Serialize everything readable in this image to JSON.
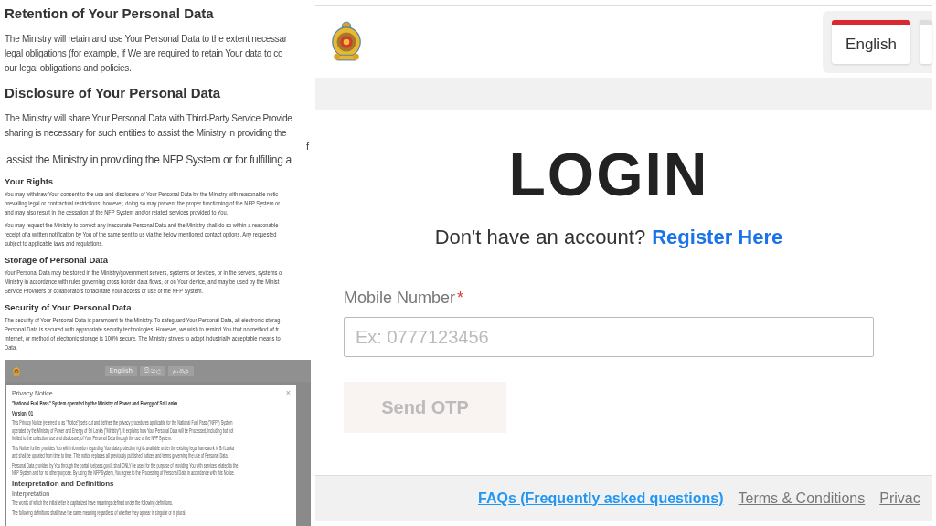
{
  "policy": {
    "blocks": [
      {
        "kind": "heading",
        "text": "Retention of Your Personal Data"
      },
      {
        "kind": "paragraph",
        "lines": [
          "The Ministry will retain and use Your Personal Data to the extent necessar",
          "legal obligations (for example, if We are required to retain Your data to co",
          "our legal obligations and policies."
        ]
      },
      {
        "kind": "heading",
        "text": "Disclosure of Your Personal Data"
      },
      {
        "kind": "paragraph",
        "lines": [
          "The Ministry will share Your Personal Data with Third-Party Service Provide",
          "sharing is necessary for such entities to assist the Ministry in providing the"
        ]
      },
      {
        "kind": "fragment",
        "text": "f"
      },
      {
        "kind": "zoomed",
        "text": "assist the Ministry in providing the NFP System or for fulfilling a"
      },
      {
        "kind": "subheading",
        "text": "Your Rights"
      },
      {
        "kind": "small",
        "lines": [
          "You may withdraw Your consent to the use and disclosure of Your Personal Data by the Ministry with reasonable notic",
          "prevailing legal or contractual restrictions; however, doing so may prevent the proper functioning of the NFP System or",
          "and may also result in the cessation of the NFP System and/or related services provided to You."
        ]
      },
      {
        "kind": "small",
        "lines": [
          "You may request the Ministry to correct any inaccurate Personal Data and the Ministry shall do so within a reasonable",
          "receipt of a written notification by You of the same sent to us via the below mentioned contact options. Any requested",
          "subject to applicable laws and regulations."
        ]
      },
      {
        "kind": "subheading",
        "text": "Storage of Personal Data"
      },
      {
        "kind": "small",
        "lines": [
          "Your Personal Data may be stored in the Ministry/government servers, systems or devices, or in the servers, systems o",
          "Ministry in accordance with rules governing cross border data flows, or on Your device, and may be used by the Minist",
          "Service Providers or collaborators to facilitate Your access or use of the NFP System."
        ]
      },
      {
        "kind": "subheading",
        "text": "Security of Your Personal Data"
      },
      {
        "kind": "small",
        "lines": [
          "The security of Your Personal Data is paramount to the Ministry. To safeguard Your Personal Data, all electronic storag",
          "Personal Data is secured with appropriate security technologies. However, we wish to remind You that no method of tr",
          "Internet, or method of electronic storage is 100% secure. The Ministry strives to adopt industrially acceptable means to",
          "Data."
        ]
      }
    ]
  },
  "embedded": {
    "languages": [
      "English",
      "සිංහල",
      "தமிழ்"
    ],
    "modal": {
      "title": "Privacy Notice",
      "close": "×",
      "blocks": [
        {
          "kind": "bold",
          "lines": [
            "\"National Fuel Pass\" System operated by the Ministry of Power and Energy of Sri Lanka"
          ]
        },
        {
          "kind": "bold",
          "lines": [
            "Version: 01"
          ]
        },
        {
          "kind": "paragraph",
          "lines": [
            "This Privacy Notice (referred to as \"Notice\") sets out and defines the privacy procedures applicable for the National Fuel Pass (\"NFP\") System",
            "operated by the Ministry of Power and Energy of Sri Lanka (\"Ministry\"). It explains how Your Personal Data will be Processed, including but not",
            "limited to the collection, use and disclosure, of Your Personal Data through the use of the NFP System."
          ]
        },
        {
          "kind": "paragraph",
          "lines": [
            "This Notice further provides You with information regarding Your data protection rights available under the existing legal framework in Sri Lanka",
            "and shall be updated from time to time. This notice replaces all previously published notices and terms governing the use of Personal Data."
          ]
        },
        {
          "kind": "paragraph",
          "lines": [
            "Personal Data provided by You through the portal fuelpass.gov.lk shall ONLY be used for the purpose of providing You with services related to the",
            "NFP System and for no other purpose. By using the NFP System, You agree to the Processing of Personal Data in accordance with this Notice."
          ]
        },
        {
          "kind": "heading",
          "lines": [
            "Interpretation and Definitions"
          ]
        },
        {
          "kind": "subheading",
          "lines": [
            "Interpretation"
          ]
        },
        {
          "kind": "paragraph",
          "lines": [
            "The words of which the initial letter is capitalized have meanings defined under the following definitions."
          ]
        },
        {
          "kind": "paragraph",
          "lines": [
            "The following definitions shall have the same meaning regardless of whether they appear in singular or in plural."
          ]
        }
      ]
    }
  },
  "login": {
    "language_tabs": [
      {
        "label": "English",
        "selected": true
      },
      {
        "selected": false
      }
    ],
    "title": "LOGIN",
    "prompt": "Don't have an account?",
    "register_link": "Register Here",
    "field": {
      "label": "Mobile Number",
      "required_mark": "*",
      "placeholder": "Ex: 0777123456"
    },
    "button": {
      "label": "Send OTP",
      "disabled": true
    },
    "footer_links": [
      {
        "label": "FAQs (Frequently asked questions)",
        "kind": "primary"
      },
      {
        "label": "Terms & Conditions",
        "kind": "secondary"
      },
      {
        "label": "Privac",
        "kind": "secondary"
      }
    ]
  }
}
